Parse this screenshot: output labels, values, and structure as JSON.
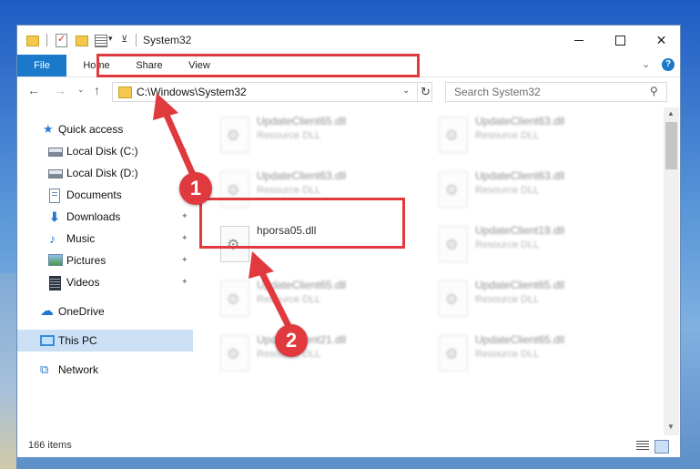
{
  "window": {
    "title": "System32",
    "controls": {
      "minimize": "",
      "maximize": "",
      "close": "✕"
    }
  },
  "ribbon": {
    "tabs": [
      "File",
      "Home",
      "Share",
      "View"
    ],
    "expand_glyph": "⌄",
    "help_glyph": "?"
  },
  "navigation": {
    "back": "←",
    "forward": "→",
    "recent": "⌄",
    "up": "↑",
    "address": "C:\\Windows\\System32",
    "address_dropdown": "⌄",
    "refresh": "↻",
    "search_placeholder": "Search System32",
    "search_glyph": "⚲"
  },
  "sidebar": {
    "items": [
      {
        "label": "Quick access",
        "icon": "star-icon",
        "pinned": false
      },
      {
        "label": "Local Disk (C:)",
        "icon": "drive-icon",
        "pinned": true
      },
      {
        "label": "Local Disk (D:)",
        "icon": "drive-icon",
        "pinned": false
      },
      {
        "label": "Documents",
        "icon": "documents-icon",
        "pinned": true
      },
      {
        "label": "Downloads",
        "icon": "download-icon",
        "pinned": true
      },
      {
        "label": "Music",
        "icon": "music-icon",
        "pinned": true
      },
      {
        "label": "Pictures",
        "icon": "pictures-icon",
        "pinned": true
      },
      {
        "label": "Videos",
        "icon": "video-icon",
        "pinned": true
      },
      {
        "label": "OneDrive",
        "icon": "cloud-icon",
        "pinned": false
      },
      {
        "label": "This PC",
        "icon": "computer-icon",
        "pinned": false,
        "selected": true
      },
      {
        "label": "Network",
        "icon": "network-icon",
        "pinned": false
      }
    ],
    "pin_glyph": "📌"
  },
  "files": [
    {
      "name": "UpdateClient65.dll",
      "type": "Resource DLL",
      "blurred": true
    },
    {
      "name": "UpdateClient63.dll",
      "type": "Resource DLL",
      "blurred": true
    },
    {
      "name": "UpdateClient63.dll",
      "type": "Resource DLL",
      "blurred": true
    },
    {
      "name": "UpdateClient63.dll",
      "type": "Resource DLL",
      "blurred": true
    },
    {
      "name": "hporsa05.dll",
      "type": "",
      "blurred": false,
      "highlighted": true
    },
    {
      "name": "UpdateClient19.dll",
      "type": "Resource DLL",
      "blurred": true
    },
    {
      "name": "UpdateClient65.dll",
      "type": "Resource DLL",
      "blurred": true
    },
    {
      "name": "UpdateClient65.dll",
      "type": "Resource DLL",
      "blurred": true
    },
    {
      "name": "UpdateClient21.dll",
      "type": "Resource DLL",
      "blurred": true
    },
    {
      "name": "UpdateClient65.dll",
      "type": "Resource DLL",
      "blurred": true
    }
  ],
  "status": {
    "item_count": "166 items"
  },
  "annotations": {
    "step1": "1",
    "step2": "2",
    "highlight_color": "#e0393e"
  }
}
